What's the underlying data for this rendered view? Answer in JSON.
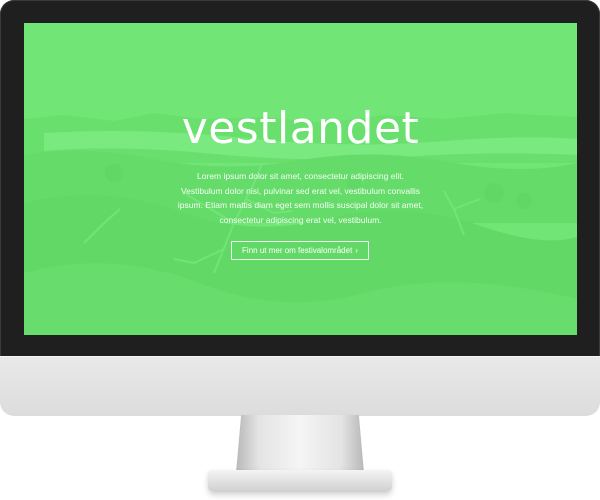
{
  "hero": {
    "title": "vestlandet",
    "body_lines": [
      "Lorem ipsum dolor sit amet, consectetur adipiscing elit.",
      "Vestibulum dolor nisi, pulvinar sed erat vel, vestibulum convallis",
      "ipsum. Etiam mattis diam eget sem mollis suscipal dolor sit amet,",
      "consectetur adipiscing erat vel, vestibulum."
    ],
    "button_label": "Finn ut mer om festivalområdet",
    "button_icon": "chevron-right-icon",
    "button_chevron": "›"
  },
  "colors": {
    "overlay": "#6eeb73",
    "text": "#ffffff",
    "bezel": "#1f1f1f",
    "chin": "#e2e2e2"
  }
}
